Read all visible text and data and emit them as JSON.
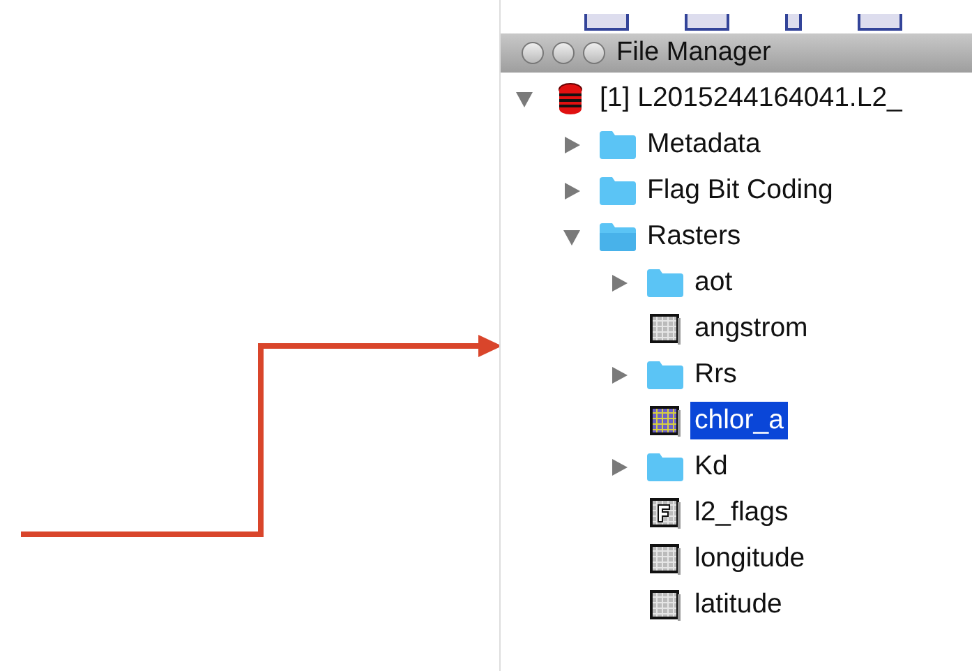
{
  "window": {
    "title": "File Manager"
  },
  "tree": [
    {
      "label": "[1] L2015244164041.L2_",
      "kind": "product",
      "expanded": true,
      "selected": false,
      "children": [
        {
          "label": "Metadata",
          "kind": "folder",
          "expanded": false,
          "selected": false
        },
        {
          "label": "Flag Bit Coding",
          "kind": "folder",
          "expanded": false,
          "selected": false
        },
        {
          "label": "Rasters",
          "kind": "folder",
          "expanded": true,
          "selected": false,
          "children": [
            {
              "label": "aot",
              "kind": "folder",
              "expanded": false,
              "selected": false
            },
            {
              "label": "angstrom",
              "kind": "raster",
              "selected": false
            },
            {
              "label": "Rrs",
              "kind": "folder",
              "expanded": false,
              "selected": false
            },
            {
              "label": "chlor_a",
              "kind": "color-raster",
              "selected": true
            },
            {
              "label": "Kd",
              "kind": "folder",
              "expanded": false,
              "selected": false
            },
            {
              "label": "l2_flags",
              "kind": "flags",
              "selected": false
            },
            {
              "label": "longitude",
              "kind": "raster",
              "selected": false
            },
            {
              "label": "latitude",
              "kind": "raster",
              "selected": false
            }
          ]
        }
      ]
    }
  ]
}
